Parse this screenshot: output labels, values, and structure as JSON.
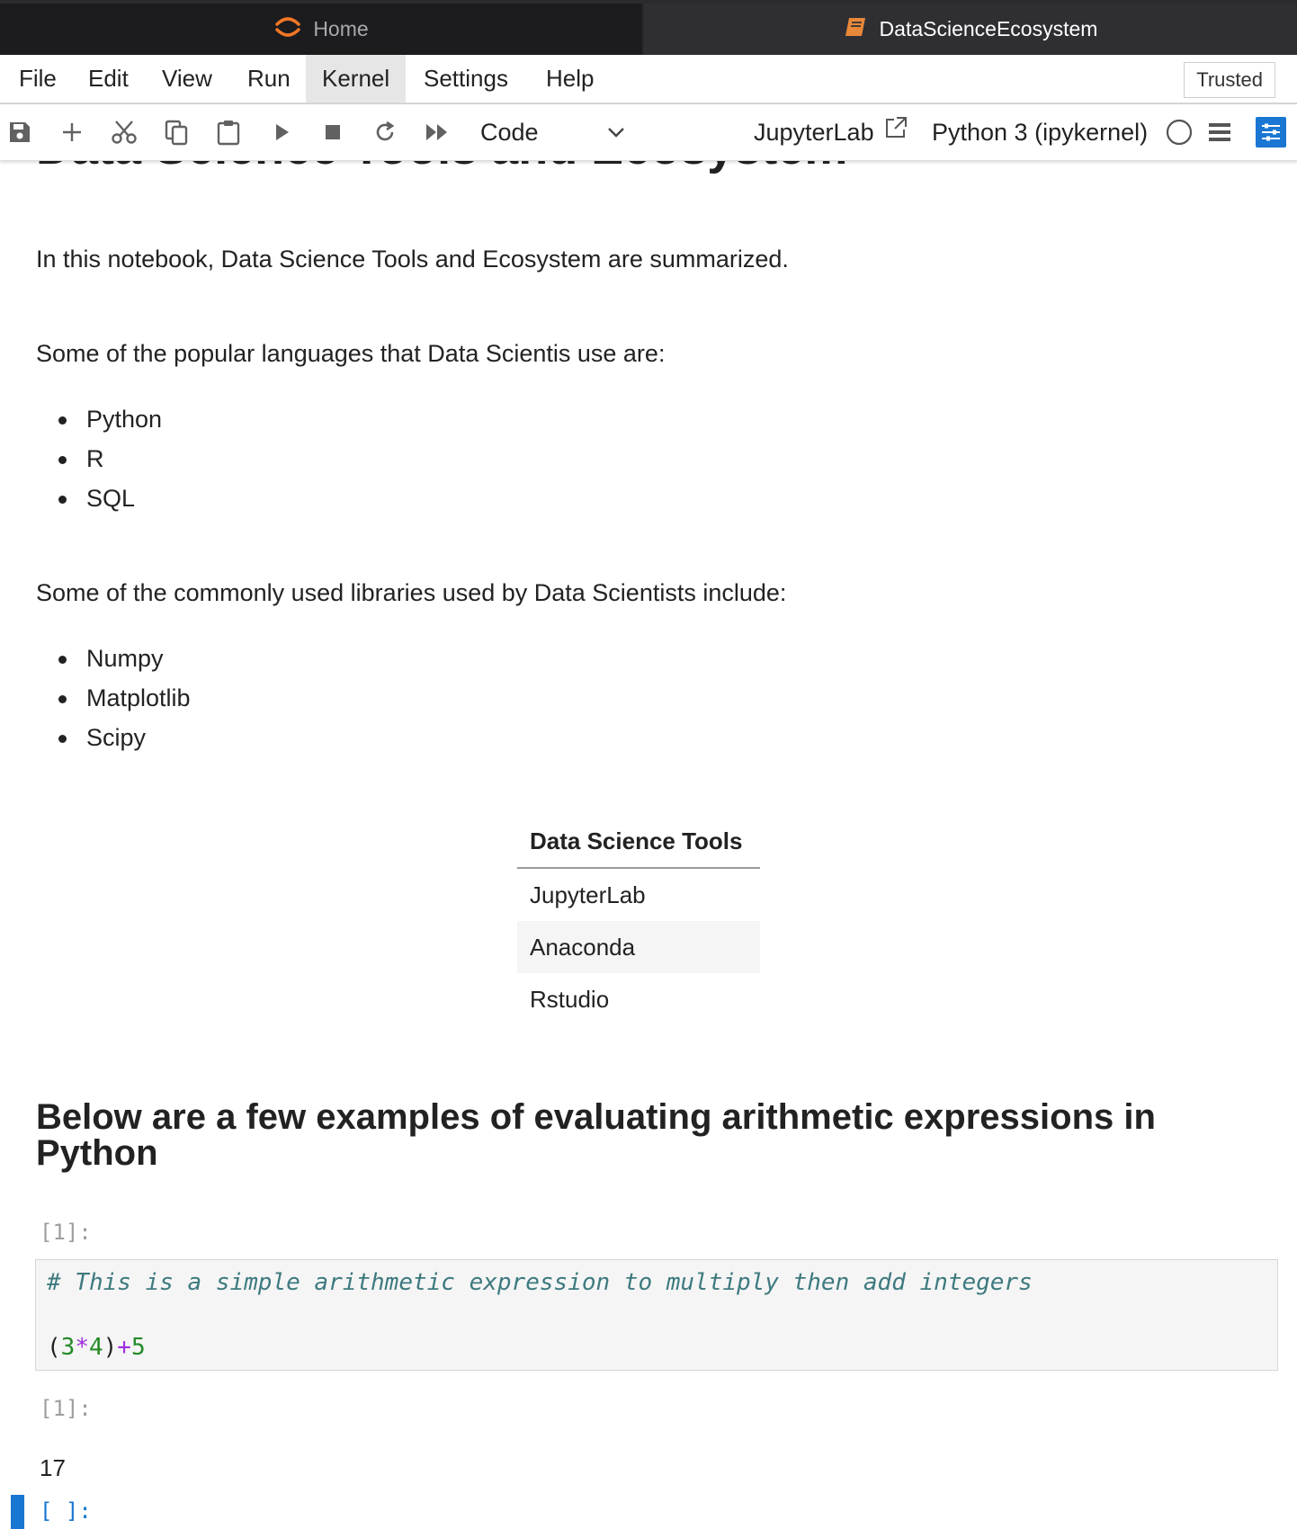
{
  "tabs": [
    {
      "label": "Home",
      "icon": "jupyter-logo-icon"
    },
    {
      "label": "DataScienceEcosystem",
      "icon": "notebook-icon"
    }
  ],
  "menu": [
    "File",
    "Edit",
    "View",
    "Run",
    "Kernel",
    "Settings",
    "Help"
  ],
  "trusted_label": "Trusted",
  "toolbar": {
    "cell_type": "Code",
    "jupyterlab_link": "JupyterLab",
    "kernel": "Python 3 (ipykernel)"
  },
  "notebook": {
    "title": "Data Science Tools and Ecosystem",
    "intro": "In this notebook, Data Science Tools and Ecosystem are summarized.",
    "languages_heading": "Some of the popular languages that Data Scientis use are:",
    "languages": [
      "Python",
      "R",
      "SQL"
    ],
    "libraries_heading": "Some of the commonly used libraries used by Data Scientists include:",
    "libraries": [
      "Numpy",
      "Matplotlib",
      "Scipy"
    ],
    "table": {
      "header": "Data Science Tools",
      "rows": [
        "JupyterLab",
        "Anaconda",
        "Rstudio"
      ]
    },
    "arith_heading": "Below are a few examples of evaluating arithmetic expressions in Python",
    "cell1": {
      "prompt": "[1]:",
      "comment": "# This is a simple arithmetic expression to multiply then add integers",
      "code": {
        "open": "(",
        "a": "3",
        "times": "*",
        "b": "4",
        "close": ")",
        "plus": "+",
        "c": "5"
      },
      "output_prompt": "[1]:",
      "output": "17"
    },
    "next_prompt": "[ ]:"
  },
  "colors": {
    "accent": "#1976d2",
    "jupyter_orange": "#f37726",
    "tabbar": "#2b2b2d"
  }
}
